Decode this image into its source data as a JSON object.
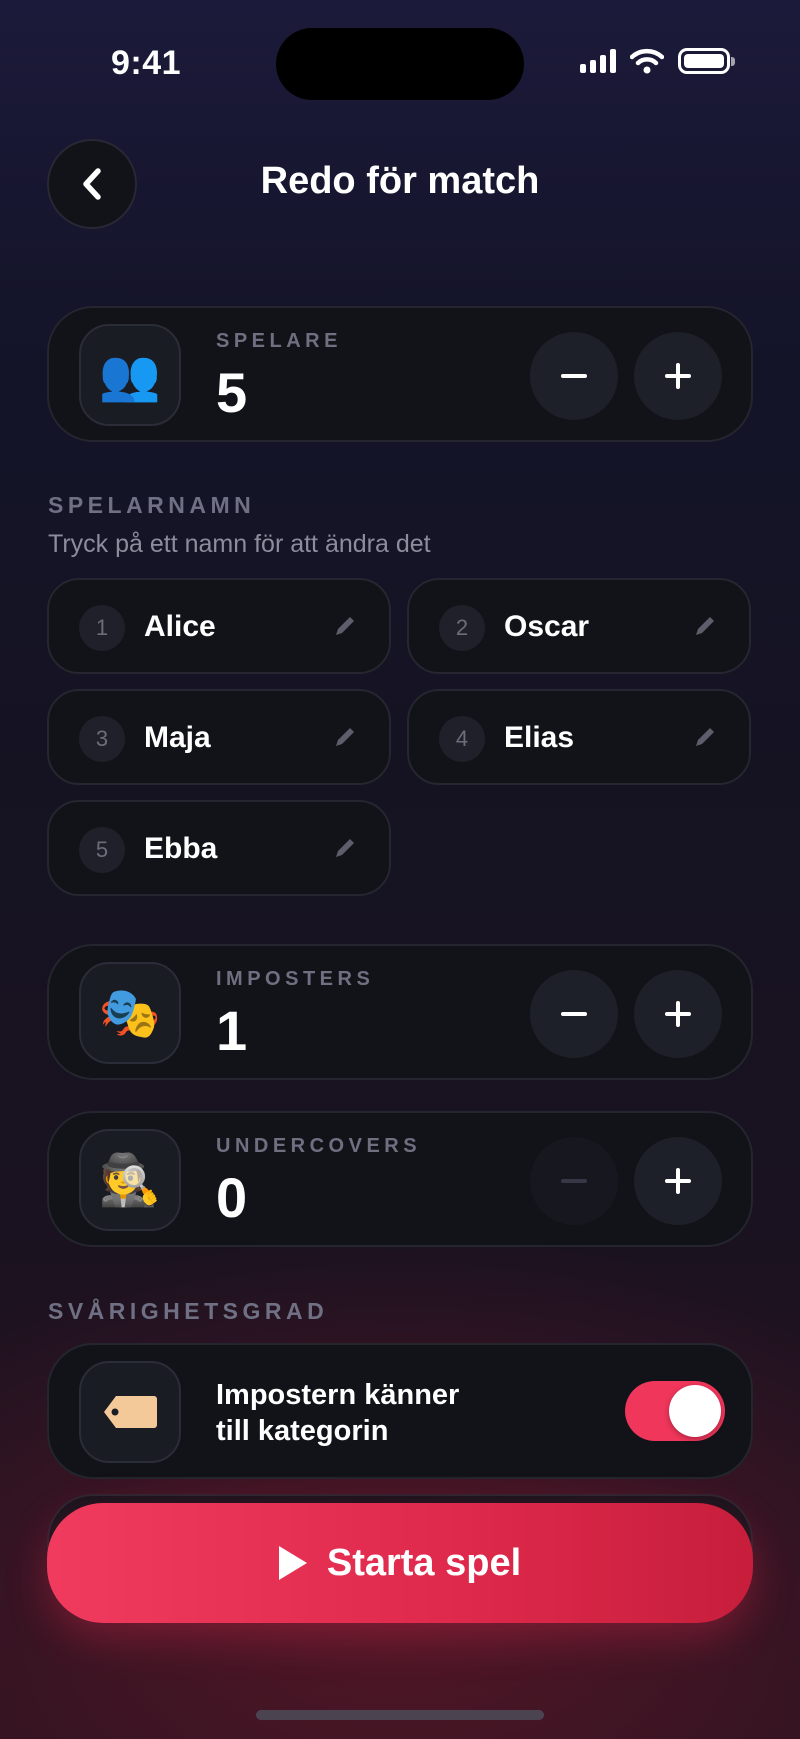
{
  "status_bar": {
    "time": "9:41"
  },
  "header": {
    "title": "Redo för match"
  },
  "players": {
    "label": "SPELARE",
    "value": "5",
    "icon": "busts-icon"
  },
  "player_names": {
    "heading": "SPELARNAMN",
    "hint": "Tryck på ett namn för att ändra det",
    "items": [
      {
        "num": "1",
        "name": "Alice"
      },
      {
        "num": "2",
        "name": "Oscar"
      },
      {
        "num": "3",
        "name": "Maja"
      },
      {
        "num": "4",
        "name": "Elias"
      },
      {
        "num": "5",
        "name": "Ebba"
      }
    ]
  },
  "imposters": {
    "label": "IMPOSTERS",
    "value": "1",
    "icon": "theater-masks-icon"
  },
  "undercovers": {
    "label": "UNDERCOVERS",
    "value": "0",
    "icon": "detective-icon"
  },
  "difficulty": {
    "heading": "SVÅRIGHETSGRAD",
    "toggle_line1": "Impostern känner",
    "toggle_line2": "till kategorin",
    "toggle_on": true,
    "icon": "label-tag-icon"
  },
  "start_button": {
    "label": "Starta spel"
  },
  "colors": {
    "accent": "#f0365b",
    "card": "#121318"
  }
}
